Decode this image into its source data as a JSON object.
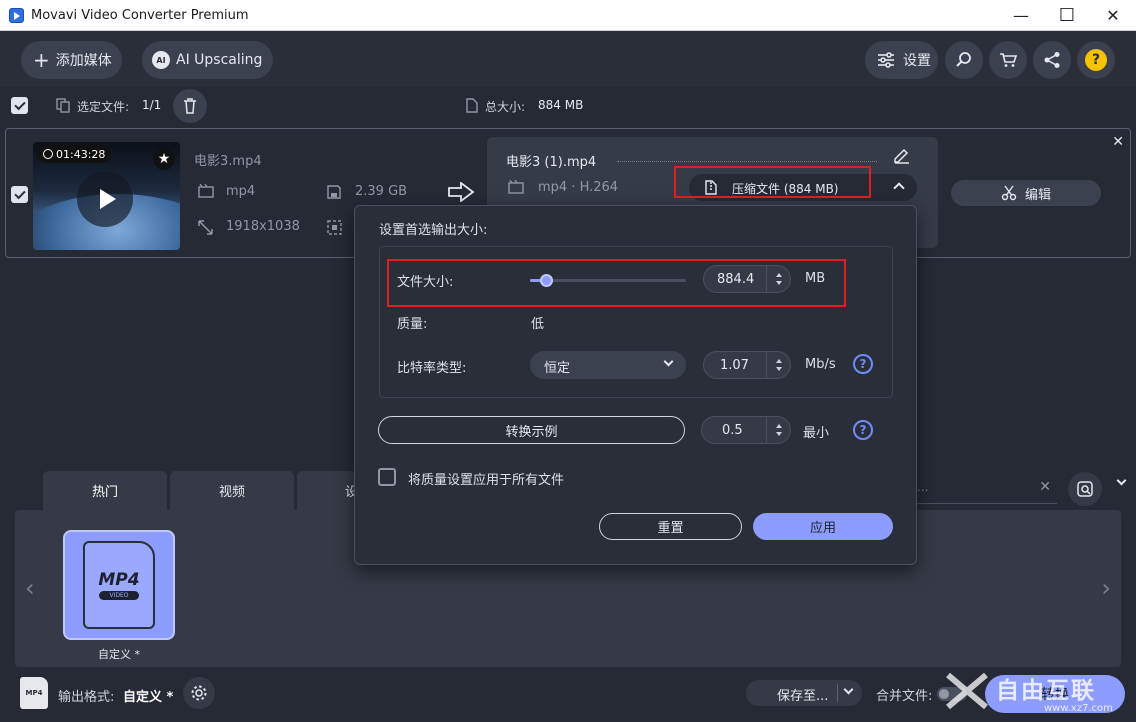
{
  "window": {
    "title": "Movavi Video Converter Premium",
    "min": "—",
    "max": "☐",
    "close": "✕"
  },
  "toolbar": {
    "add_media": "添加媒体",
    "ai_upscaling": "AI Upscaling",
    "settings": "设置"
  },
  "selection": {
    "selected_label": "选定文件:",
    "selected_count": "1/1",
    "total_label": "总大小:",
    "total_size": "884 MB"
  },
  "file": {
    "duration": "01:43:28",
    "name": "电影3.mp4",
    "format": "mp4",
    "size": "2.39 GB",
    "resolution": "1918x1038"
  },
  "output": {
    "name": "电影3 (1).mp4",
    "codec": "mp4 · H.264",
    "compress_label": "压缩文件 (884 MB)",
    "edit_label": "编辑"
  },
  "dialog": {
    "title": "设置首选输出大小:",
    "file_size_label": "文件大小:",
    "file_size_value": "884.4",
    "file_size_unit": "MB",
    "slider_level": 0.1,
    "quality_label": "质量:",
    "quality_value": "低",
    "bitrate_type_label": "比特率类型:",
    "bitrate_type_value": "恒定",
    "bitrate_value": "1.07",
    "bitrate_unit": "Mb/s",
    "sample_button": "转换示例",
    "sample_value": "0.5",
    "sample_unit": "最小",
    "apply_all_label": "将质量设置应用于所有文件",
    "reset_button": "重置",
    "apply_button": "应用",
    "help": "?"
  },
  "tabs": [
    "热门",
    "视频",
    "设"
  ],
  "search": {
    "placeholder_visible": "..."
  },
  "format": {
    "badge_main": "MP4",
    "badge_sub": "VIDEO",
    "label": "自定义 *"
  },
  "status": {
    "output_format_label": "输出格式:",
    "output_format_value": "自定义 *",
    "save_to": "保存至...",
    "merge_label": "合并文件:",
    "convert": "转换",
    "status_icon_text": "MP4"
  },
  "watermark": {
    "text": "自由互联",
    "url": "www.xz7.com"
  },
  "colors": {
    "accent": "#8c9cff",
    "highlight": "#e02020",
    "bg": "#262a35"
  }
}
